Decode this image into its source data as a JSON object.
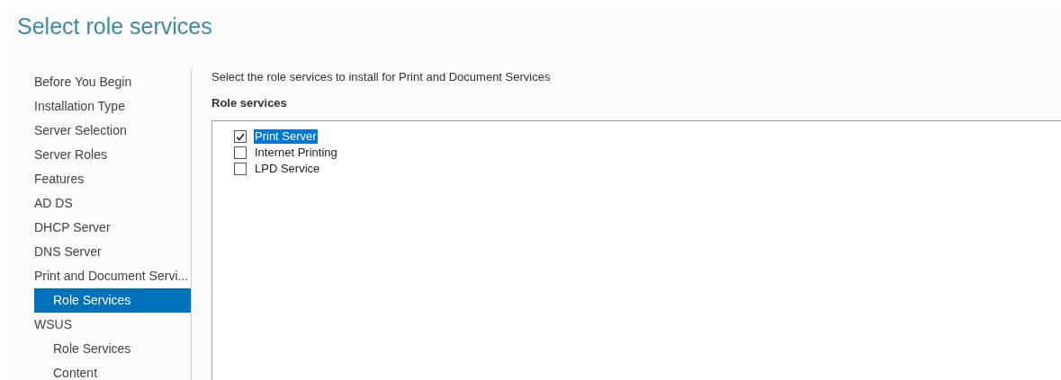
{
  "title": "Select role services",
  "nav": [
    {
      "label": "Before You Begin",
      "selected": false
    },
    {
      "label": "Installation Type",
      "selected": false
    },
    {
      "label": "Server Selection",
      "selected": false
    },
    {
      "label": "Server Roles",
      "selected": false
    },
    {
      "label": "Features",
      "selected": false
    },
    {
      "label": "AD DS",
      "selected": false
    },
    {
      "label": "DHCP Server",
      "selected": false
    },
    {
      "label": "DNS Server",
      "selected": false
    },
    {
      "label": "Print and Document Servi...",
      "selected": false,
      "children": [
        {
          "label": "Role Services",
          "selected": true
        }
      ]
    },
    {
      "label": "WSUS",
      "selected": false,
      "children": [
        {
          "label": "Role Services",
          "selected": false
        },
        {
          "label": "Content",
          "selected": false
        }
      ]
    }
  ],
  "instruction": "Select the role services to install for Print and Document Services",
  "list_heading": "Role services",
  "role_services": [
    {
      "label": "Print Server",
      "checked": true,
      "selected": true
    },
    {
      "label": "Internet Printing",
      "checked": false,
      "selected": false
    },
    {
      "label": "LPD Service",
      "checked": false,
      "selected": false
    }
  ]
}
